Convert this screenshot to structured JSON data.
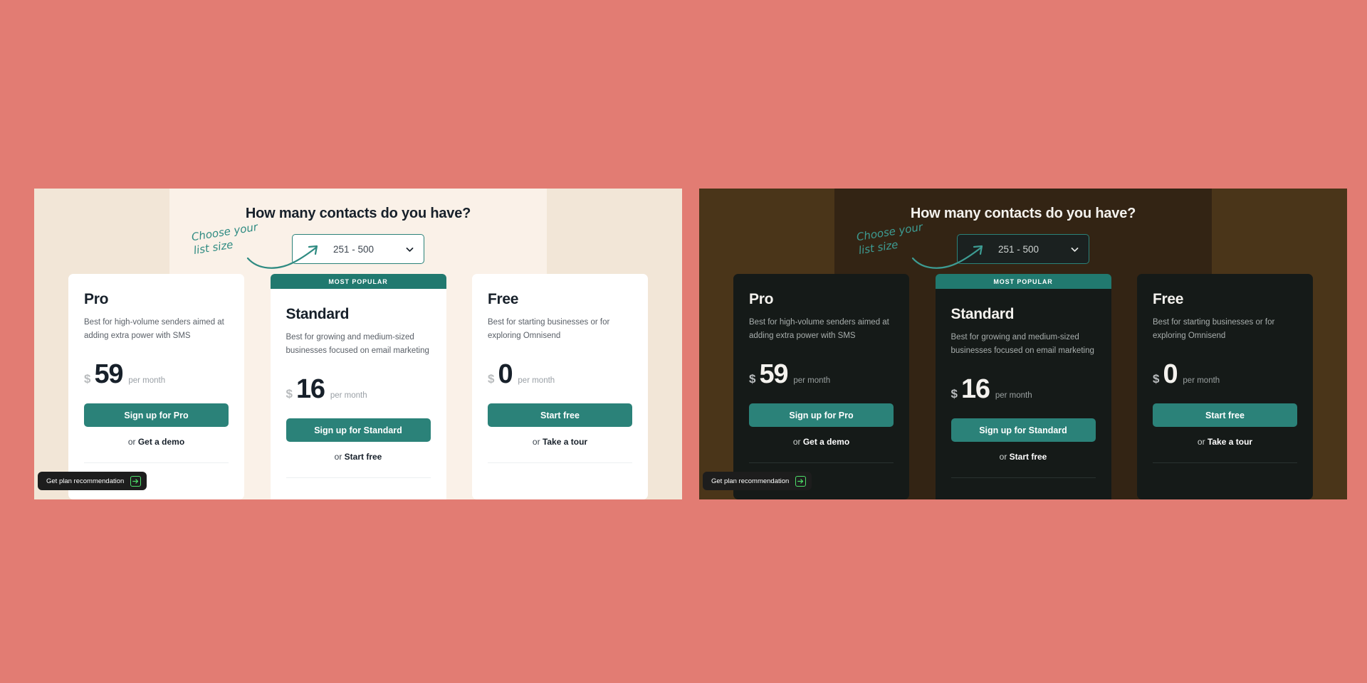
{
  "background_color": "#e27c73",
  "accent_color": "#2b8279",
  "panels": [
    {
      "theme": "light",
      "name": "light-theme-preview",
      "bg_side": "#f2e6d7",
      "bg_center": "#faf1e8"
    },
    {
      "theme": "dark",
      "name": "dark-theme-preview",
      "bg_side": "#4a3519",
      "bg_center": "#332414"
    }
  ],
  "selector": {
    "title": "How many contacts do you have?",
    "value": "251 - 500",
    "chevron_icon": "chevron-down-icon",
    "annotation": "Choose your\nlist size",
    "annotation_arrow_icon": "curved-arrow-icon"
  },
  "popular_badge": "MOST POPULAR",
  "plans": [
    {
      "name": "Pro",
      "description": "Best for high-volume senders aimed at adding extra power with SMS",
      "currency": "$",
      "amount": "59",
      "period": "per month",
      "cta": "Sign up for Pro",
      "sub_prefix": "or ",
      "sub_link": "Get a demo",
      "featured": false
    },
    {
      "name": "Standard",
      "description": "Best for growing and medium-sized businesses focused on email marketing",
      "currency": "$",
      "amount": "16",
      "period": "per month",
      "cta": "Sign up for Standard",
      "sub_prefix": "or ",
      "sub_link": "Start free",
      "featured": true
    },
    {
      "name": "Free",
      "description": "Best for starting businesses or for exploring Omnisend",
      "currency": "$",
      "amount": "0",
      "period": "per month",
      "cta": "Start free",
      "sub_prefix": "or ",
      "sub_link": "Take a tour",
      "featured": false
    }
  ],
  "recommendation_pill": {
    "label": "Get plan recommendation",
    "icon": "arrow-right-box-icon",
    "icon_color": "#4ee06a"
  }
}
